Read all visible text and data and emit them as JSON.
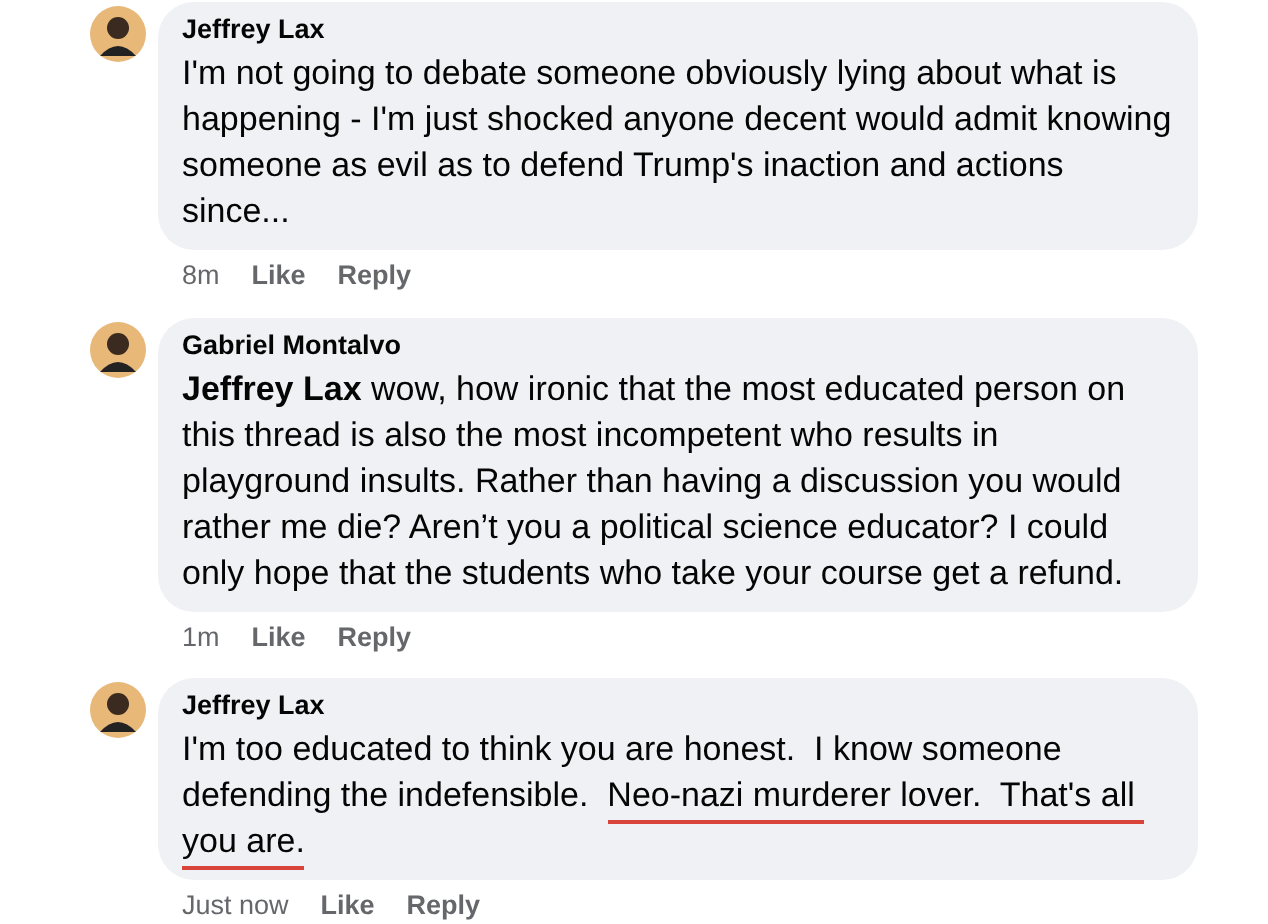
{
  "comments": [
    {
      "author": "Jeffrey Lax",
      "segments": [
        {
          "text": "I'm not going to debate someone obviously lying about what is happening - I'm just shocked anyone decent would admit knowing someone as evil as to defend Trump's inaction and actions since...",
          "underlined": false
        }
      ],
      "time": "8m",
      "actions": [
        "Like",
        "Reply"
      ]
    },
    {
      "author": "Gabriel Montalvo",
      "segments": [
        {
          "text": "**Jeffrey Lax** wow, how ironic that the most educated person on this thread is also the most incompetent who results in playground insults. Rather than having a discussion you would rather me die? Aren’t you a political science educator? I could only hope that the students who take your course get a refund.",
          "underlined": false
        }
      ],
      "time": "1m",
      "actions": [
        "Like",
        "Reply"
      ]
    },
    {
      "author": "Jeffrey Lax",
      "segments": [
        {
          "text": "I'm too educated to think you are honest.  I know someone defending the indefensible.  ",
          "underlined": false
        },
        {
          "text": "Neo-nazi murderer lover.",
          "underlined": true
        },
        {
          "text": "  That's all",
          "underlined": true
        },
        {
          "text": " you are.",
          "underlined": true
        }
      ],
      "time": "Just now",
      "actions": [
        "Like",
        "Reply"
      ]
    }
  ]
}
